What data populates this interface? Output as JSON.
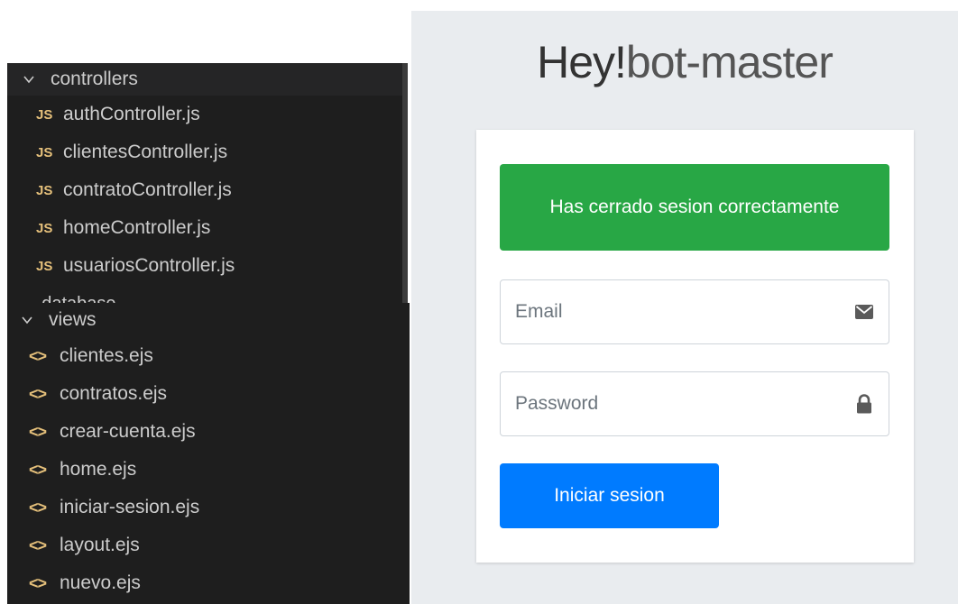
{
  "explorer": {
    "controllers_folder": "controllers",
    "controllers_files": [
      {
        "badge": "JS",
        "name": "authController.js"
      },
      {
        "badge": "JS",
        "name": "clientesController.js"
      },
      {
        "badge": "JS",
        "name": "contratoController.js"
      },
      {
        "badge": "JS",
        "name": "homeController.js"
      },
      {
        "badge": "JS",
        "name": "usuariosController.js"
      }
    ],
    "cut_folder": "database",
    "views_folder": "views",
    "views_files": [
      {
        "badge": "<>",
        "name": "clientes.ejs"
      },
      {
        "badge": "<>",
        "name": "contratos.ejs"
      },
      {
        "badge": "<>",
        "name": "crear-cuenta.ejs"
      },
      {
        "badge": "<>",
        "name": "home.ejs"
      },
      {
        "badge": "<>",
        "name": "iniciar-sesion.ejs"
      },
      {
        "badge": "<>",
        "name": "layout.ejs"
      },
      {
        "badge": "<>",
        "name": "nuevo.ejs"
      }
    ],
    "folder_icon": "chevron-down-icon"
  },
  "login": {
    "brand_strong": "Hey!",
    "brand_light": "bot-master",
    "alert_text": "Has cerrado sesion correctamente",
    "email_placeholder": "Email",
    "email_icon": "envelope-icon",
    "password_placeholder": "Password",
    "password_icon": "lock-icon",
    "submit_label": "Iniciar sesion"
  },
  "colors": {
    "editor_bg": "#1e1e1e",
    "js_badge": "#e5c07b",
    "page_bg": "#e9ecef",
    "alert_success": "#28a745",
    "primary_button": "#007bff"
  }
}
